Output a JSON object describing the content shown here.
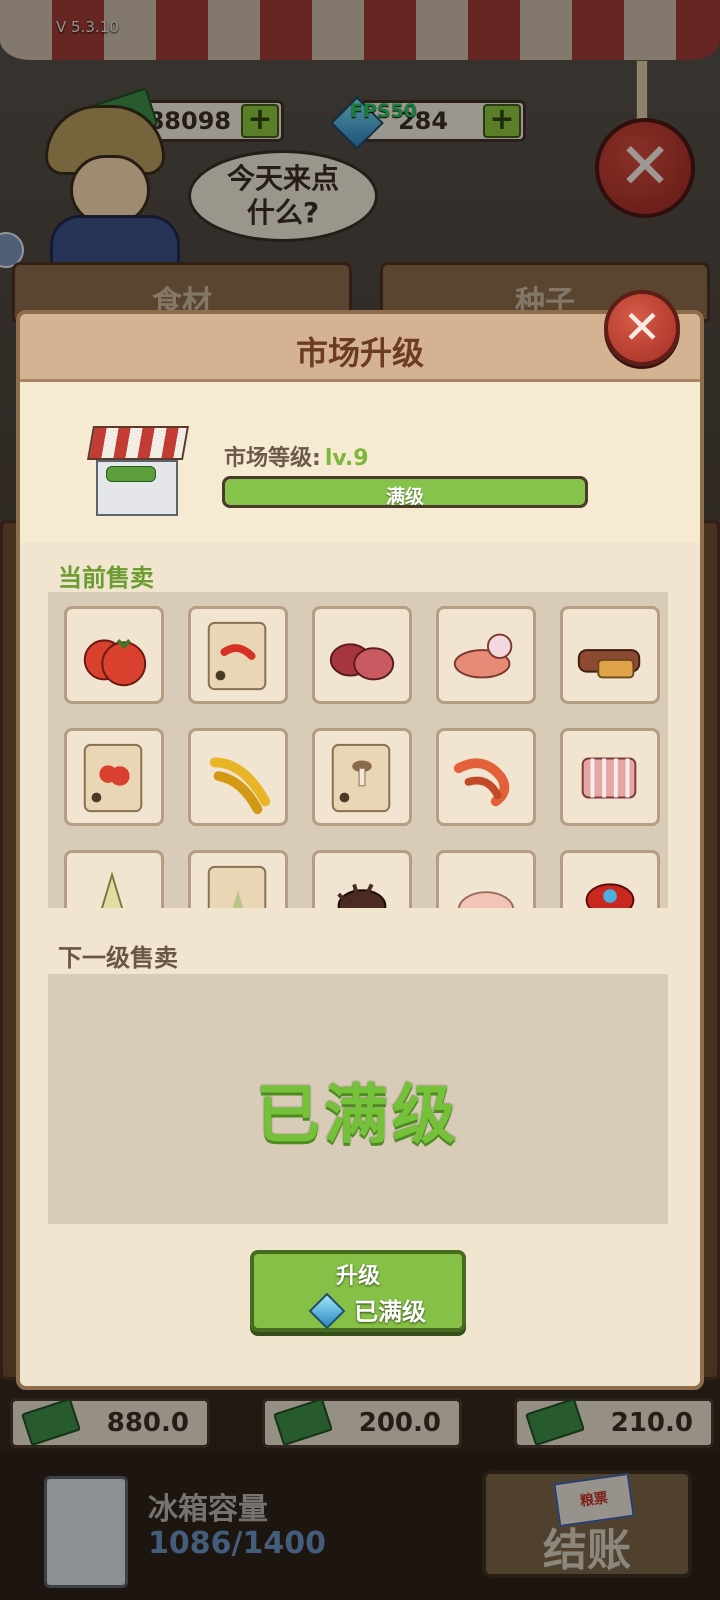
{
  "hud": {
    "version": "V 5.3.10",
    "cash": "188098",
    "gems": "284",
    "fps": "FPS50",
    "npc_speech_line1": "今天来点",
    "npc_speech_line2": "什么?",
    "plus": "+",
    "close": "✕"
  },
  "tabs": [
    "食材",
    "种子"
  ],
  "modal": {
    "title": "市场升级",
    "close": "✕",
    "level_label": "市场等级:",
    "level_value": "lv.9",
    "progress_text": "满级",
    "progress_fraction": 1.0,
    "current_title": "当前售卖",
    "next_title": "下一级售卖",
    "max_text": "已满级",
    "upgrade_label": "升级",
    "upgrade_cost": "已满级"
  },
  "items": [
    {
      "name": "tomato-icon",
      "color": "#d9402e"
    },
    {
      "name": "chili-seed-bag-icon",
      "color": "#d83024"
    },
    {
      "name": "liver-meat-icon",
      "color": "#a5363e"
    },
    {
      "name": "pork-slices-icon",
      "color": "#e88a78"
    },
    {
      "name": "cured-meat-icon",
      "color": "#8c4a32"
    },
    {
      "name": "tomato-seed-bag-icon",
      "color": "#d9402e"
    },
    {
      "name": "yellow-pepper-icon",
      "color": "#e7b526"
    },
    {
      "name": "mushroom-seed-bag-icon",
      "color": "#8a6a4a"
    },
    {
      "name": "shrimp-icon",
      "color": "#e4603a"
    },
    {
      "name": "ribs-icon",
      "color": "#e6a6a4"
    },
    {
      "name": "bamboo-shoot-icon",
      "color": "#e4dca0"
    },
    {
      "name": "bamboo-seed-bag-icon",
      "color": "#b8c488"
    },
    {
      "name": "sea-cucumber-icon",
      "color": "#4a2a22"
    },
    {
      "name": "chicken-feet-icon",
      "color": "#f2c4b6"
    },
    {
      "name": "crab-icon",
      "color": "#c8281e"
    }
  ],
  "bottom": {
    "prices": [
      "880.0",
      "200.0",
      "210.0"
    ],
    "fridge_label": "冰箱容量",
    "fridge_capacity": "1086/1400",
    "ticket": "粮票",
    "checkout": "结账"
  }
}
